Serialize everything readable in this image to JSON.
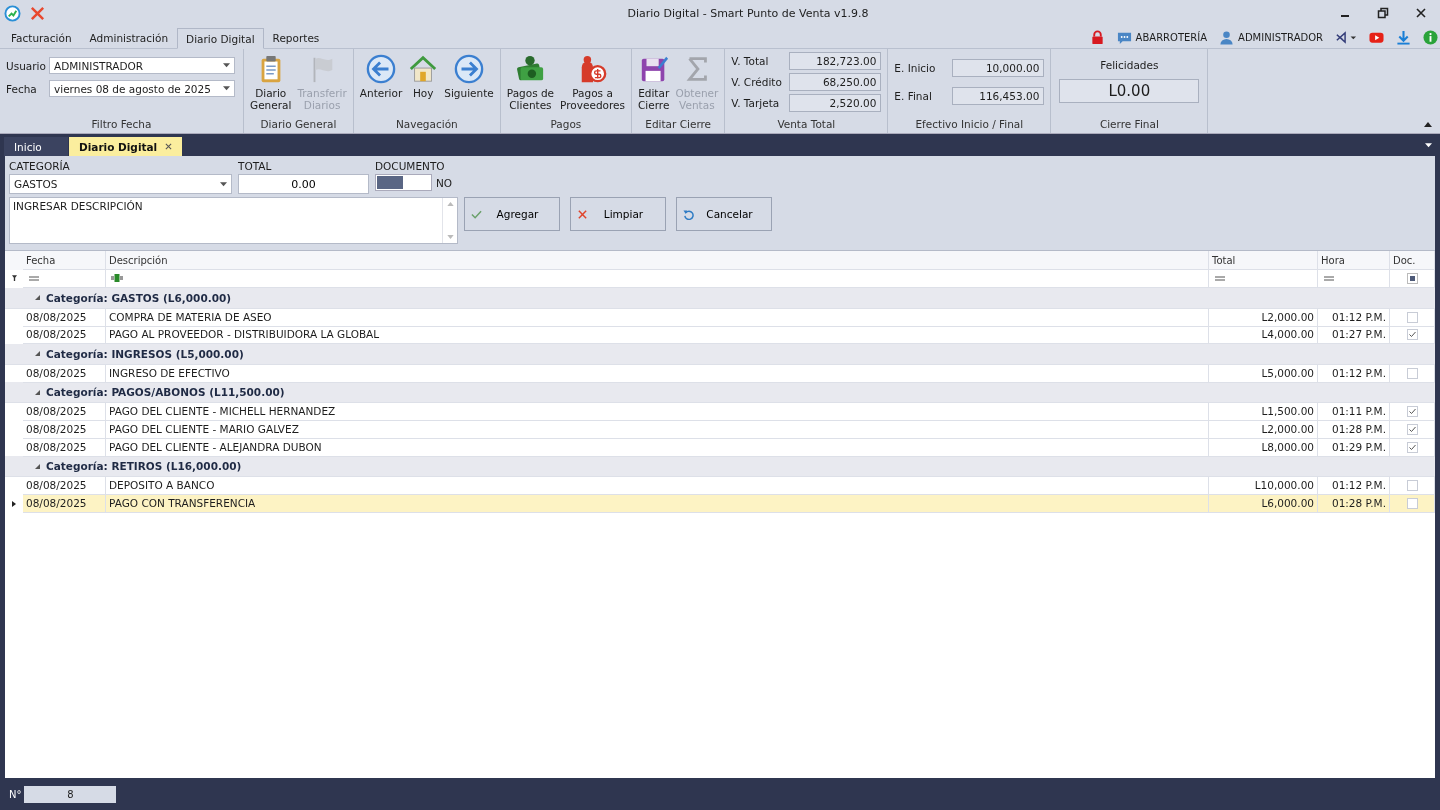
{
  "window": {
    "title": "Diario Digital - Smart Punto de Venta v1.9.8"
  },
  "menu_tabs": [
    {
      "label": "Facturación",
      "selected": false
    },
    {
      "label": "Administración",
      "selected": false
    },
    {
      "label": "Diario Digital",
      "selected": true
    },
    {
      "label": "Reportes",
      "selected": false
    }
  ],
  "header_right": {
    "store": "ABARROTERÍA",
    "user": "ADMINISTRADOR"
  },
  "filter": {
    "usuario_label": "Usuario",
    "usuario": "ADMINISTRADOR",
    "fecha_label": "Fecha",
    "fecha": "viernes 08 de agosto de 2025",
    "group": "Filtro Fecha"
  },
  "ribbon_groups": [
    {
      "label": "Diario General",
      "buttons": [
        {
          "label": "Diario\nGeneral",
          "disabled": false
        },
        {
          "label": "Transferir\nDiarios",
          "disabled": true
        }
      ]
    },
    {
      "label": "Navegación",
      "buttons": [
        {
          "label": "Anterior",
          "disabled": false
        },
        {
          "label": "Hoy",
          "disabled": false
        },
        {
          "label": "Siguiente",
          "disabled": false
        }
      ]
    },
    {
      "label": "Pagos",
      "buttons": [
        {
          "label": "Pagos de\nClientes",
          "disabled": false
        },
        {
          "label": "Pagos a\nProveedores",
          "disabled": false
        }
      ]
    },
    {
      "label": "Editar Cierre",
      "buttons": [
        {
          "label": "Editar\nCierre",
          "disabled": false
        },
        {
          "label": "Obtener\nVentas",
          "disabled": true
        }
      ]
    }
  ],
  "venta_total": {
    "group": "Venta Total",
    "fields": [
      {
        "label": "V. Total",
        "value": "182,723.00"
      },
      {
        "label": "V. Crédito",
        "value": "68,250.00"
      },
      {
        "label": "V. Tarjeta",
        "value": "2,520.00"
      }
    ]
  },
  "efectivo": {
    "group": "Efectivo Inicio / Final",
    "fields": [
      {
        "label": "E. Inicio",
        "value": "10,000.00"
      },
      {
        "label": "E. Final",
        "value": "116,453.00"
      }
    ]
  },
  "cierre_final": {
    "group": "Cierre Final",
    "message": "Felicidades",
    "value": "L0.00"
  },
  "doc_tabs": [
    {
      "label": "Inicio",
      "selected": false
    },
    {
      "label": "Diario Digital",
      "selected": true
    }
  ],
  "form": {
    "categoria": {
      "label": "CATEGORÍA",
      "value": "GASTOS"
    },
    "total": {
      "label": "TOTAL",
      "value": "0.00"
    },
    "documento": {
      "label": "DOCUMENTO",
      "on": false,
      "state_text": "NO"
    },
    "descripcion": {
      "value": "INGRESAR DESCRIPCIÓN"
    },
    "buttons": [
      {
        "label": "Agregar"
      },
      {
        "label": "Limpiar"
      },
      {
        "label": "Cancelar"
      }
    ]
  },
  "grid": {
    "columns": [
      {
        "label": "Fecha"
      },
      {
        "label": "Descripción"
      },
      {
        "label": "Total"
      },
      {
        "label": "Hora"
      },
      {
        "label": "Doc."
      }
    ],
    "groups": [
      {
        "title": "Categoría: GASTOS (L6,000.00)",
        "expanded": true,
        "rows": [
          {
            "fecha": "08/08/2025",
            "descripcion": "COMPRA DE MATERIA DE ASEO",
            "total": "L2,000.00",
            "hora": "01:12 P.M.",
            "doc": false,
            "selected": false
          },
          {
            "fecha": "08/08/2025",
            "descripcion": "PAGO AL PROVEEDOR - DISTRIBUIDORA LA GLOBAL",
            "total": "L4,000.00",
            "hora": "01:27 P.M.",
            "doc": true,
            "selected": false
          }
        ]
      },
      {
        "title": "Categoría: INGRESOS (L5,000.00)",
        "expanded": true,
        "rows": [
          {
            "fecha": "08/08/2025",
            "descripcion": "INGRESO DE EFECTIVO",
            "total": "L5,000.00",
            "hora": "01:12 P.M.",
            "doc": false,
            "selected": false
          }
        ]
      },
      {
        "title": "Categoría: PAGOS/ABONOS (L11,500.00)",
        "expanded": true,
        "rows": [
          {
            "fecha": "08/08/2025",
            "descripcion": "PAGO DEL CLIENTE - MICHELL HERNANDEZ",
            "total": "L1,500.00",
            "hora": "01:11 P.M.",
            "doc": true,
            "selected": false
          },
          {
            "fecha": "08/08/2025",
            "descripcion": "PAGO DEL CLIENTE - MARIO GALVEZ",
            "total": "L2,000.00",
            "hora": "01:28 P.M.",
            "doc": true,
            "selected": false
          },
          {
            "fecha": "08/08/2025",
            "descripcion": "PAGO DEL CLIENTE - ALEJANDRA DUBON",
            "total": "L8,000.00",
            "hora": "01:29 P.M.",
            "doc": true,
            "selected": false
          }
        ]
      },
      {
        "title": "Categoría: RETIROS (L16,000.00)",
        "expanded": true,
        "rows": [
          {
            "fecha": "08/08/2025",
            "descripcion": "DEPOSITO A BANCO",
            "total": "L10,000.00",
            "hora": "01:12 P.M.",
            "doc": false,
            "selected": false
          },
          {
            "fecha": "08/08/2025",
            "descripcion": "PAGO CON TRANSFERENCIA",
            "total": "L6,000.00",
            "hora": "01:28 P.M.",
            "doc": false,
            "selected": true
          }
        ]
      }
    ]
  },
  "status_bar": {
    "label": "N°",
    "count": "8"
  }
}
